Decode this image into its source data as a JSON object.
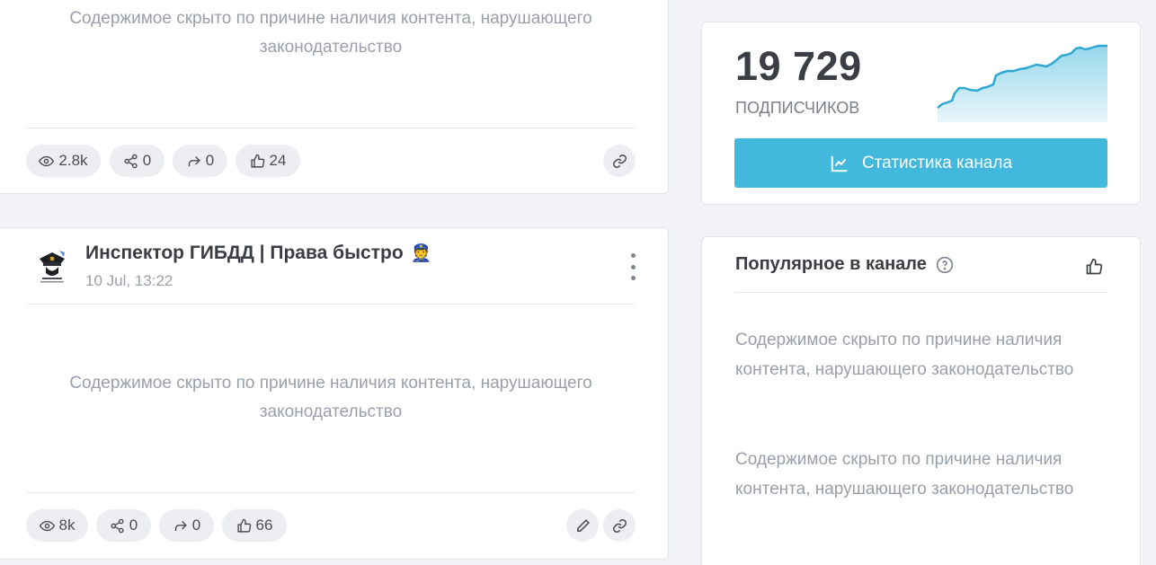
{
  "posts": [
    {
      "hidden_text": "Содержимое скрыто по причине наличия контента, нарушающего законодательство",
      "stats": {
        "views": "2.8k",
        "shares": "0",
        "forwards": "0",
        "likes": "24"
      }
    },
    {
      "channel_name": "Инспектор ГИБДД | Права быстро",
      "channel_emoji": "👮",
      "date": "10 Jul, 13:22",
      "hidden_text": "Содержимое скрыто по причине наличия контента, нарушающего законодательство",
      "stats": {
        "views": "8k",
        "shares": "0",
        "forwards": "0",
        "likes": "66"
      }
    }
  ],
  "sidebar": {
    "subscribers_count": "19 729",
    "subscribers_label": "ПОДПИСЧИКОВ",
    "stats_button": "Статистика канала",
    "popular_title": "Популярное в канале",
    "popular_items": [
      "Содержимое скрыто по причине наличия контента, нарушающего законодательство",
      "Содержимое скрыто по причине наличия контента, нарушающего законодательство"
    ]
  },
  "colors": {
    "accent": "#41b8dc",
    "muted_text": "#99a0ab",
    "pill_bg": "#eceef2"
  },
  "icons": {
    "views": "eye-icon",
    "shares": "share-nodes-icon",
    "forwards": "forward-arrow-icon",
    "likes": "thumbs-up-icon",
    "link": "link-icon",
    "edit": "pencil-icon",
    "stats": "chart-line-icon",
    "help": "question-circle-icon"
  }
}
